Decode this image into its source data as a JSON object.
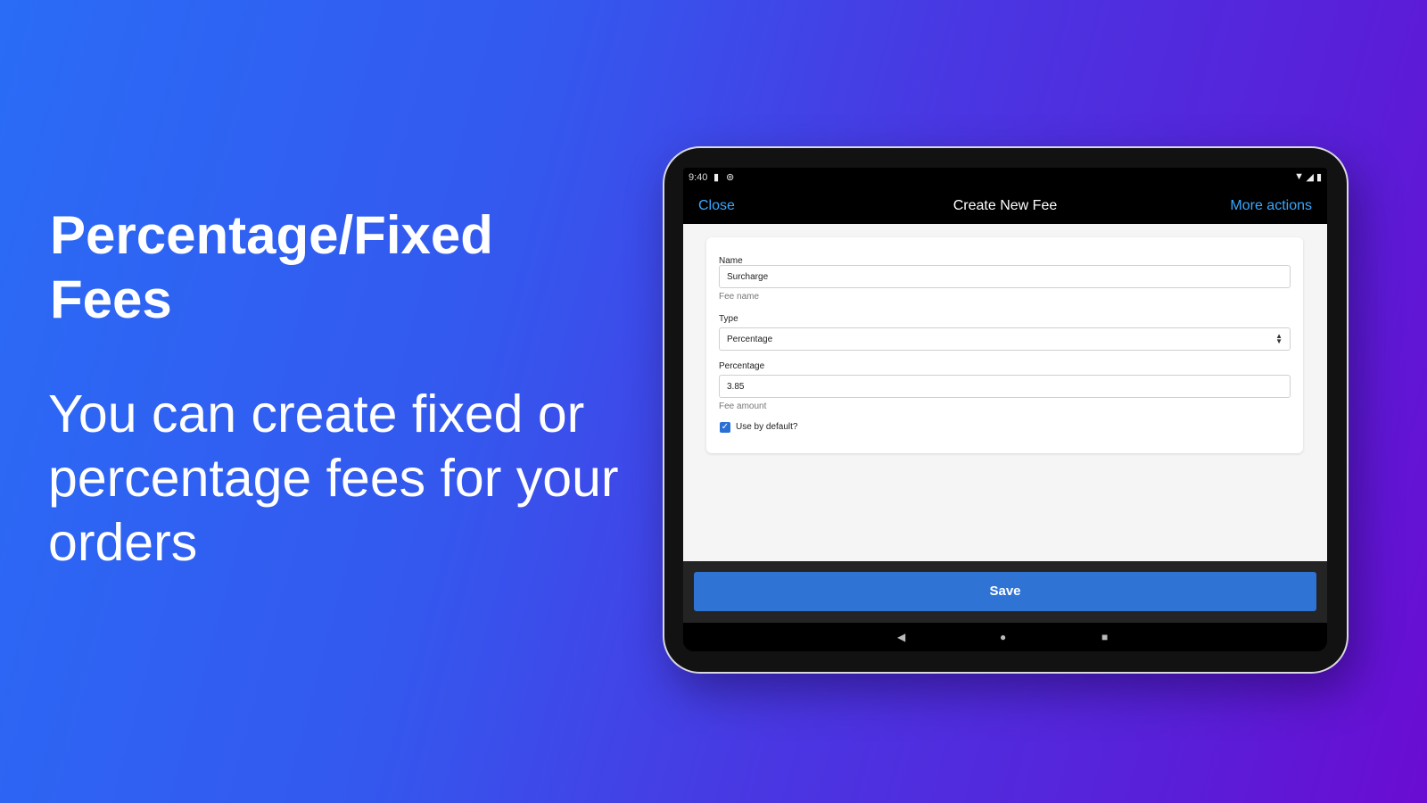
{
  "promo": {
    "title": "Percentage/Fixed Fees",
    "body": "You can create fixed or percentage fees for your orders"
  },
  "status_bar": {
    "time": "9:40",
    "icons": [
      "sd-card-icon",
      "sync-icon",
      "wifi-icon",
      "signal-icon",
      "battery-icon"
    ]
  },
  "header": {
    "close_label": "Close",
    "title": "Create New Fee",
    "more_label": "More actions"
  },
  "form": {
    "name": {
      "label": "Name",
      "value": "Surcharge",
      "hint": "Fee name"
    },
    "type": {
      "label": "Type",
      "value": "Percentage"
    },
    "percentage": {
      "label": "Percentage",
      "value": "3.85",
      "hint": "Fee amount"
    },
    "use_default": {
      "label": "Use by default?",
      "checked": true
    }
  },
  "save_label": "Save",
  "colors": {
    "accent": "#2f74d4",
    "link": "#3aa8ff"
  }
}
